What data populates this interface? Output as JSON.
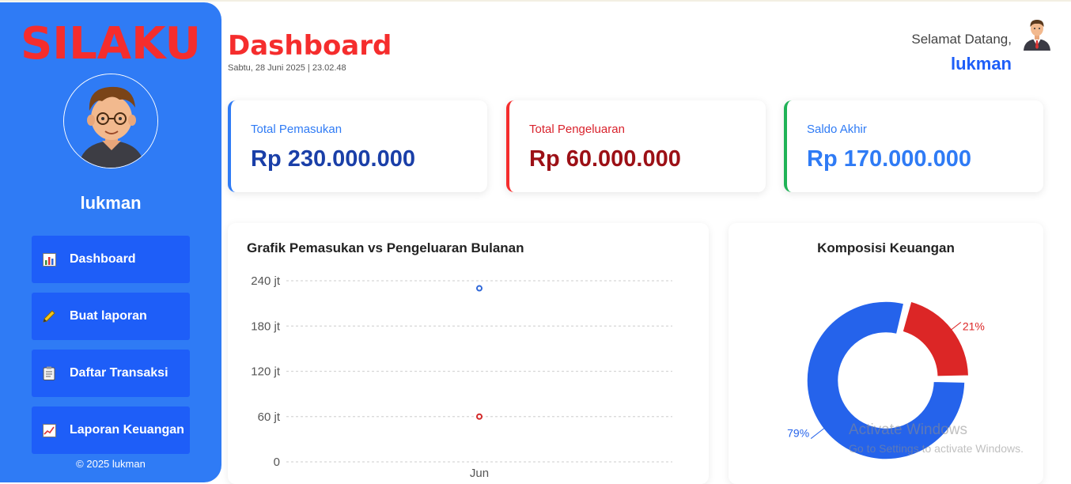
{
  "sidebar": {
    "brand": "SILAKU",
    "user_name": "lukman",
    "items": [
      {
        "label": "Dashboard",
        "icon": "bar-chart-icon"
      },
      {
        "label": "Buat laporan",
        "icon": "pencil-icon"
      },
      {
        "label": "Daftar Transaksi",
        "icon": "clipboard-icon"
      },
      {
        "label": "Laporan Keuangan",
        "icon": "line-chart-icon"
      }
    ],
    "footer": "© 2025 lukman"
  },
  "header": {
    "title": "Dashboard",
    "datetime": "Sabtu, 28 Juni 2025 | 23.02.48",
    "welcome": "Selamat Datang,",
    "user_name": "lukman"
  },
  "cards": [
    {
      "label": "Total Pemasukan",
      "value": "Rp 230.000.000",
      "accent": "#2f7bf5",
      "label_color": "#2f7bf5",
      "value_color": "#1a3fa8"
    },
    {
      "label": "Total Pengeluaran",
      "value": "Rp 60.000.000",
      "accent": "#f52d2d",
      "label_color": "#d9232d",
      "value_color": "#9c1016"
    },
    {
      "label": "Saldo Akhir",
      "value": "Rp 170.000.000",
      "accent": "#1fb256",
      "label_color": "#2f7bf5",
      "value_color": "#2f7bf5"
    }
  ],
  "chart_data": [
    {
      "type": "scatter",
      "title": "Grafik Pemasukan vs Pengeluaran Bulanan",
      "categories": [
        "Jun"
      ],
      "ylim": [
        0,
        240
      ],
      "yticks": [
        0,
        60,
        120,
        180,
        240
      ],
      "ytick_labels": [
        "0",
        "60 jt",
        "120 jt",
        "180 jt",
        "240 jt"
      ],
      "grid": true,
      "series": [
        {
          "values": [
            230
          ],
          "color": "#2f67d8"
        },
        {
          "values": [
            60
          ],
          "color": "#d42a2a"
        }
      ]
    },
    {
      "type": "pie",
      "title": "Komposisi Keuangan",
      "slices": [
        {
          "value": 79,
          "label": "79%",
          "color": "#2563eb"
        },
        {
          "value": 21,
          "label": "21%",
          "color": "#dc2626"
        }
      ]
    }
  ],
  "watermark": {
    "line1": "Activate Windows",
    "line2": "Go to Settings to activate Windows."
  }
}
